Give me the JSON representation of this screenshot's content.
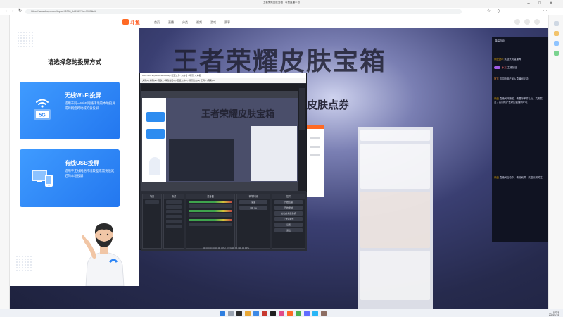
{
  "browser": {
    "window_title": "王者荣耀皮肤宝箱 - 斗鱼直播平台",
    "url": "https://www.douyu.com/topic/KGS90_lbf9967?rid=9999&dit",
    "back_icon": "back-arrow-icon",
    "forward_icon": "forward-arrow-icon",
    "refresh_icon": "refresh-icon"
  },
  "site": {
    "logo": "斗鱼",
    "nav": [
      "首页",
      "直播",
      "分类",
      "视频",
      "游戏",
      "赛事"
    ]
  },
  "background": {
    "banner": "王者荣耀皮肤宝箱",
    "voucher": "皮肤点券"
  },
  "chat": {
    "title": "弹幕互动",
    "messages": [
      {
        "user": "系统提示",
        "text": "欢迎来到直播间"
      },
      {
        "user": "水友",
        "text": "主播加油"
      },
      {
        "user": "官方",
        "text": "欢迎新用户加入直播间互动"
      },
      {
        "user": "系统",
        "text": "直播间开播啦，请遵守弹幕礼仪，文明发言，共同维护良好的直播间环境"
      },
      {
        "user": "系统",
        "text": "直播间互动中，请勿刷屏，欢迎点赞关注"
      }
    ],
    "colors": {
      "name": "#f7b500",
      "highlight": "#ff6a6a"
    }
  },
  "obs": {
    "title": "OBS 30.0.2 (64-bit, windows) - 配置文件: 未命名 - 场景: 未命名",
    "menu": "文件(F)  编辑(E)  视图(V)  停靠窗口(D)  配置文件(P)  场景集合(S)  工具(T)  帮助(H)",
    "docks": {
      "scenes": "场景",
      "sources": "来源",
      "mixer": "混音器",
      "transitions": "转场特效",
      "controls": "控件"
    },
    "controls": [
      "开始直播",
      "开始录制",
      "启动虚拟摄像机",
      "工作室模式",
      "设置",
      "退出"
    ],
    "transition_value": "渐变",
    "duration_value": "300 ms",
    "status": "00:00:00  00:00:00  CPU: 0.5%  30.00 / 30.00 FPS"
  },
  "modal": {
    "title": "请选择您的投屏方式",
    "options": [
      {
        "title": "无线Wi-Fi投屏",
        "desc": "适用于同一Wi-Fi网络环境的本地投屏或跨网络跨地域的云投屏",
        "icon": "wifi-5g-icon"
      },
      {
        "title": "有线USB投屏",
        "desc": "适用于无线网络环境较差或需要低延迟的本地投屏",
        "icon": "usb-devices-icon"
      }
    ],
    "illustration": "man-pointing-illustration",
    "accent": "#2f86f5"
  },
  "taskbar": {
    "time": "16:01",
    "date": "2024/1/14"
  }
}
